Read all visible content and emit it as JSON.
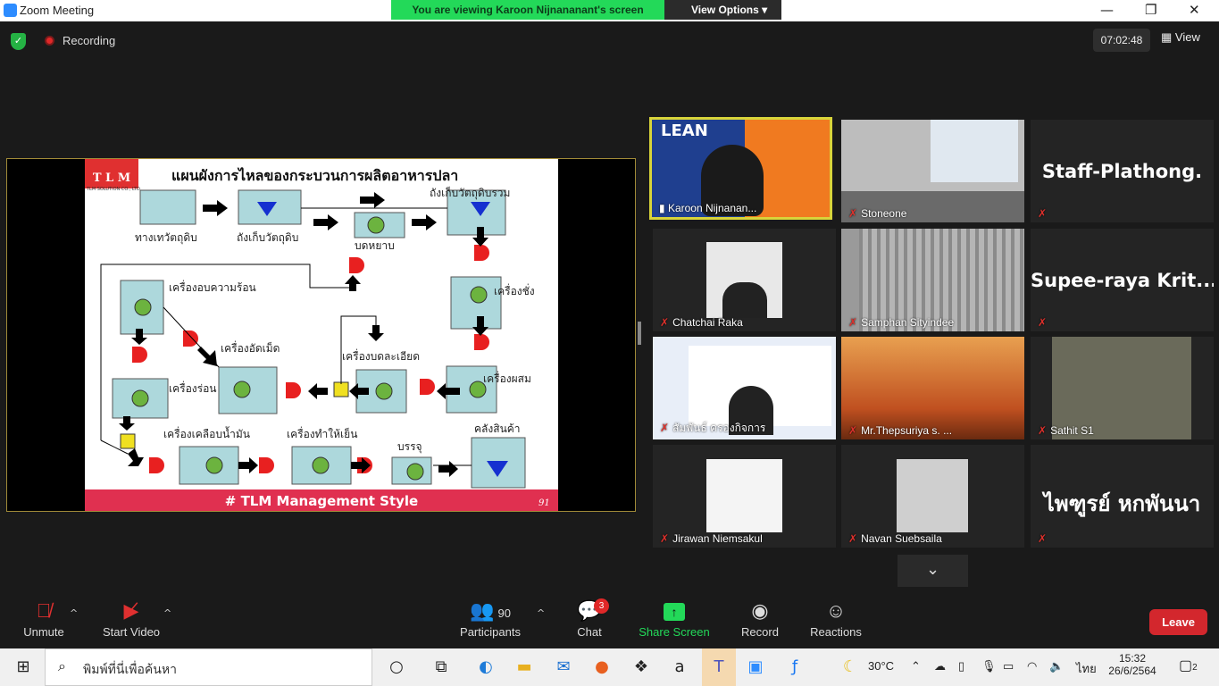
{
  "window": {
    "title": "Zoom Meeting",
    "minimize": "—",
    "maximize": "❐",
    "close": "✕"
  },
  "banner": {
    "viewing": "You are viewing Karoon Nijnananant's screen",
    "view_options": "View Options ▾"
  },
  "top": {
    "recording": "Recording",
    "timer": "07:02:48",
    "view": "View"
  },
  "slide": {
    "title": "แผนผังการไหลของกระบวนการผลิตอาหารปลา",
    "logo": "T L M",
    "logo_sub": "TLM SOLUTION CO., LTD.",
    "footer": "# TLM Management Style",
    "page": "91",
    "labels": [
      "ทางเทวัตถุดิบ",
      "ถังเก็บวัตถุดิบ",
      "บดหยาบ",
      "ถังเก็บวัตถุดิบรวม",
      "เครื่องอบความร้อน",
      "เครื่องอัดเม็ด",
      "เครื่องชั่ง",
      "เครื่องบดละเอียด",
      "เครื่องร่อน",
      "เครื่องผสม",
      "เครื่องเคลือบน้ำมัน",
      "เครื่องทำให้เย็น",
      "บรรจุ",
      "คลังสินค้า"
    ]
  },
  "participants": [
    {
      "name": "Karoon Nijnanan...",
      "big": "",
      "slide_text": "LEAN"
    },
    {
      "name": "Stoneone",
      "big": ""
    },
    {
      "name": "",
      "big": "Staff-Plathong."
    },
    {
      "name": "Chatchai Raka",
      "big": ""
    },
    {
      "name": "Samphan Sityindee",
      "big": ""
    },
    {
      "name": "",
      "big": "Supee-raya  Krit..."
    },
    {
      "name": "สัมพันธ์ ครองกิจการ",
      "big": ""
    },
    {
      "name": "Mr.Thepsuriya  s. ...",
      "big": ""
    },
    {
      "name": "Sathit S1",
      "big": ""
    },
    {
      "name": "Jirawan Niemsakul",
      "big": ""
    },
    {
      "name": "Navan Suebsaila",
      "big": ""
    },
    {
      "name": "",
      "big": "ไพฑูรย์ หกพันนา"
    }
  ],
  "toolbar": {
    "unmute": "Unmute",
    "start_video": "Start Video",
    "participants": "Participants",
    "participants_count": "90",
    "chat": "Chat",
    "chat_badge": "3",
    "share_screen": "Share Screen",
    "record": "Record",
    "reactions": "Reactions",
    "leave": "Leave"
  },
  "colors": {
    "share_green": "#23d959",
    "leave_red": "#d3272d",
    "active_border": "#d8d43a"
  },
  "taskbar": {
    "search_placeholder": "พิมพ์ที่นี่เพื่อค้นหา",
    "temp": "30°C",
    "lang": "ไทย",
    "time": "15:32",
    "date": "26/6/2564",
    "notif": "2"
  }
}
